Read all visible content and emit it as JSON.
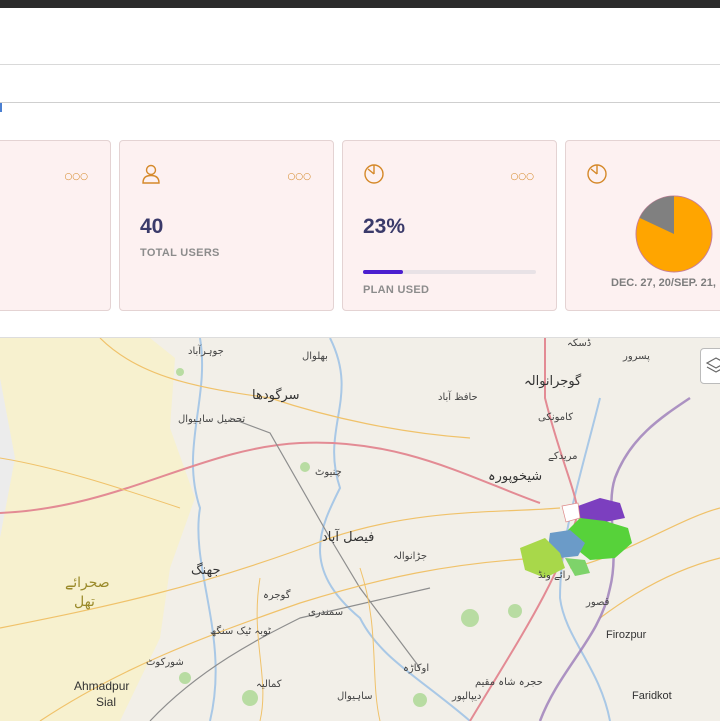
{
  "cards": {
    "users": {
      "value": "40",
      "label": "TOTAL USERS",
      "icon": "user-icon"
    },
    "plan": {
      "value": "23%",
      "label": "PLAN USED",
      "progress_percent": 23,
      "icon": "gauge-icon"
    },
    "period": {
      "date_range": "DEC. 27, 20/SEP. 21,",
      "icon": "gauge-icon",
      "pie_used_percent": 18
    }
  },
  "colors": {
    "accent": "#d5892a",
    "card_bg": "#fdf1f1",
    "progress": "#4b1fcf",
    "pie_main": "#ffa500",
    "pie_slice": "#808080"
  },
  "map": {
    "labels": [
      {
        "text": "جوہرآباد"
      },
      {
        "text": "بھلوال"
      },
      {
        "text": "ڈسکہ"
      },
      {
        "text": "پسرور"
      },
      {
        "text": "گوجرانوالہ"
      },
      {
        "text": "سرگودھا"
      },
      {
        "text": "حافظ آباد"
      },
      {
        "text": "کامونکی"
      },
      {
        "text": "تحصیل ساہیوال"
      },
      {
        "text": "مریدکے"
      },
      {
        "text": "چنیوٹ"
      },
      {
        "text": "شیخوپورہ"
      },
      {
        "text": "فیصل آباد"
      },
      {
        "text": "جڑانوالہ"
      },
      {
        "text": "جھنگ"
      },
      {
        "text": "صحرائے"
      },
      {
        "text": "تھل"
      },
      {
        "text": "رائے ونڈ"
      },
      {
        "text": "گوجرہ"
      },
      {
        "text": "قصور"
      },
      {
        "text": "سمندری"
      },
      {
        "text": "ٹوبہ ٹیک سنگھ"
      },
      {
        "text": "Firozpur"
      },
      {
        "text": "شورکوٹ"
      },
      {
        "text": "اوکاڑہ"
      },
      {
        "text": "حجرہ شاہ مقیم"
      },
      {
        "text": "Ahmadpur"
      },
      {
        "text": "Sial"
      },
      {
        "text": "کمالیہ"
      },
      {
        "text": "ساہیوال"
      },
      {
        "text": "دیپالپور"
      },
      {
        "text": "Faridkot"
      }
    ]
  }
}
